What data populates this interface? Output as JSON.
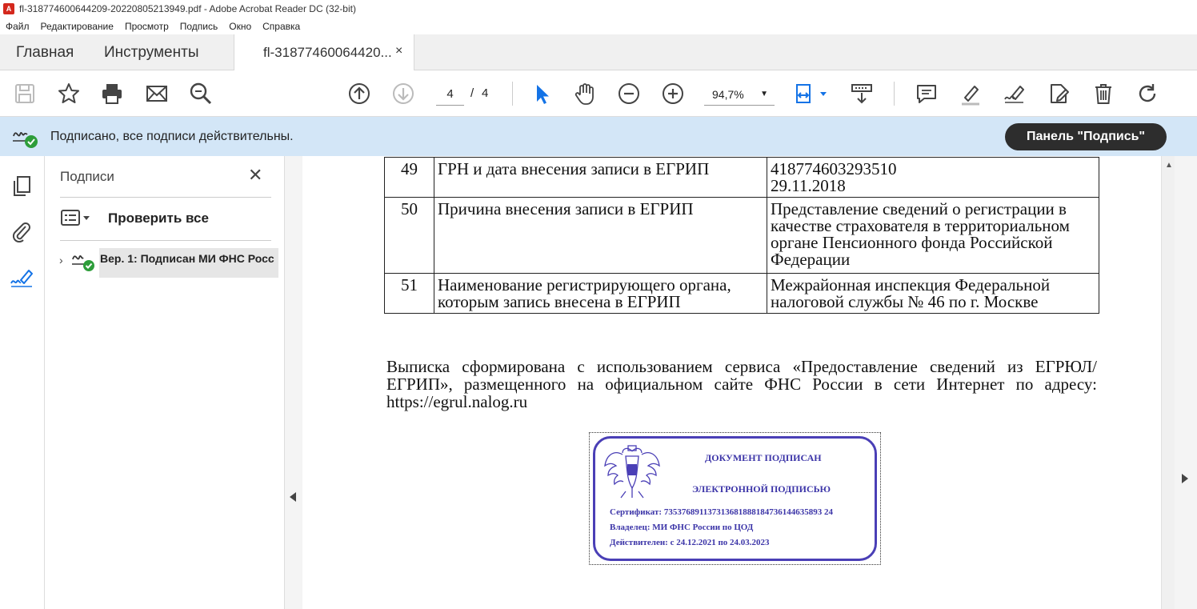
{
  "window": {
    "title": "fl-318774600644209-20220805213949.pdf - Adobe Acrobat Reader DC (32-bit)"
  },
  "menu": [
    "Файл",
    "Редактирование",
    "Просмотр",
    "Подпись",
    "Окно",
    "Справка"
  ],
  "tabs": {
    "home": "Главная",
    "tools": "Инструменты",
    "doc": "fl-31877460064420...",
    "close": "×"
  },
  "toolbar": {
    "page_current": "4",
    "page_sep": "/",
    "page_total": "4",
    "zoom": "94,7%"
  },
  "sigbar": {
    "message": "Подписано, все подписи действительны.",
    "panel_button": "Панель \"Подпись\""
  },
  "sigpanel": {
    "title": "Подписи",
    "close": "✕",
    "verify_all": "Проверить все",
    "entry": "Вер. 1: Подписан МИ ФНС Росс"
  },
  "document": {
    "rows": [
      {
        "num": "49",
        "field": "ГРН и дата внесения записи в ЕГРИП",
        "value": "418774603293510\n29.11.2018"
      },
      {
        "num": "50",
        "field": "Причина внесения записи в ЕГРИП",
        "value": "Представление сведений о регистрации в качестве страхователя в территориальном органе Пенсионного фонда Российской Федерации"
      },
      {
        "num": "51",
        "field": "Наименование регистрирующего органа, которым запись внесена в ЕГРИП",
        "value": "Межрайонная инспекция Федеральной налоговой службы № 46 по г. Москве"
      }
    ],
    "paragraph": "Выписка сформирована с использованием сервиса «Предоставление сведений из ЕГРЮЛ/ЕГРИП», размещенного на официальном сайте ФНС России в сети Интернет по адресу: https://egrul.nalog.ru",
    "stamp": {
      "line1": "ДОКУМЕНТ ПОДПИСАН",
      "line2": "ЭЛЕКТРОННОЙ ПОДПИСЬЮ",
      "certificate": "Сертификат: 735376891137313681888184736144635893 24",
      "owner": "Владелец: МИ ФНС России по ЦОД",
      "valid": "Действителен: с 24.12.2021 по 24.03.2023"
    }
  },
  "colors": {
    "accent": "#1473e6",
    "sigbar_bg": "#d3e6f7",
    "stamp": "#3c35a8",
    "ok_green": "#2d9d3a"
  }
}
